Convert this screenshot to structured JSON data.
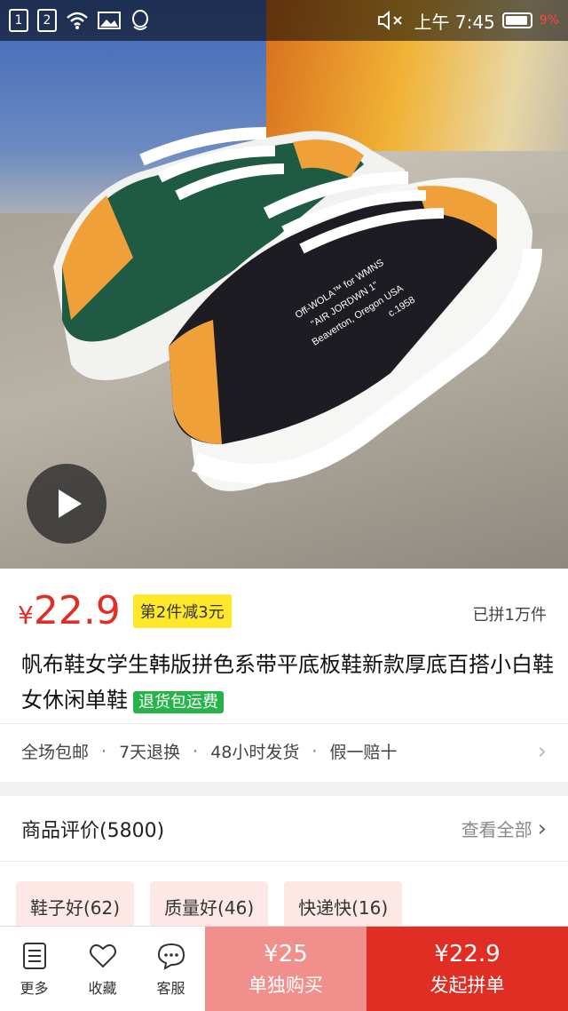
{
  "status_bar": {
    "sim1": "1",
    "sim2": "2",
    "time": "上午 7:45",
    "battery_pct": "9%"
  },
  "product": {
    "currency": "¥",
    "price": "22.9",
    "promo": "第2件减3元",
    "sold": "已拼1万件",
    "title": "帆布鞋女学生韩版拼色系带平底板鞋新款厚底百搭小白鞋女休闲单鞋",
    "title_tag": "退货包运费",
    "shoe_print": {
      "line1": "Off-WOLA™ for WMNS",
      "line2": "\"AIR JORDWN 1\"",
      "line3": "Beaverton, Oregon USA",
      "line4": "c.1958"
    }
  },
  "services": [
    "全场包邮",
    "7天退换",
    "48小时发货",
    "假一赔十"
  ],
  "reviews": {
    "title": "商品评价(5800)",
    "view_all": "查看全部",
    "chips": [
      "鞋子好(62)",
      "质量好(46)",
      "快递快(16)"
    ]
  },
  "bottom_bar": {
    "more": "更多",
    "favorite": "收藏",
    "service": "客服",
    "single_price": "¥25",
    "single_label": "单独购买",
    "group_price": "¥22.9",
    "group_label": "发起拼单"
  },
  "colors": {
    "accent_red": "#e02e24",
    "light_red": "#f08f8b",
    "promo_yellow": "#ffe82a",
    "tag_green": "#25b34a"
  }
}
